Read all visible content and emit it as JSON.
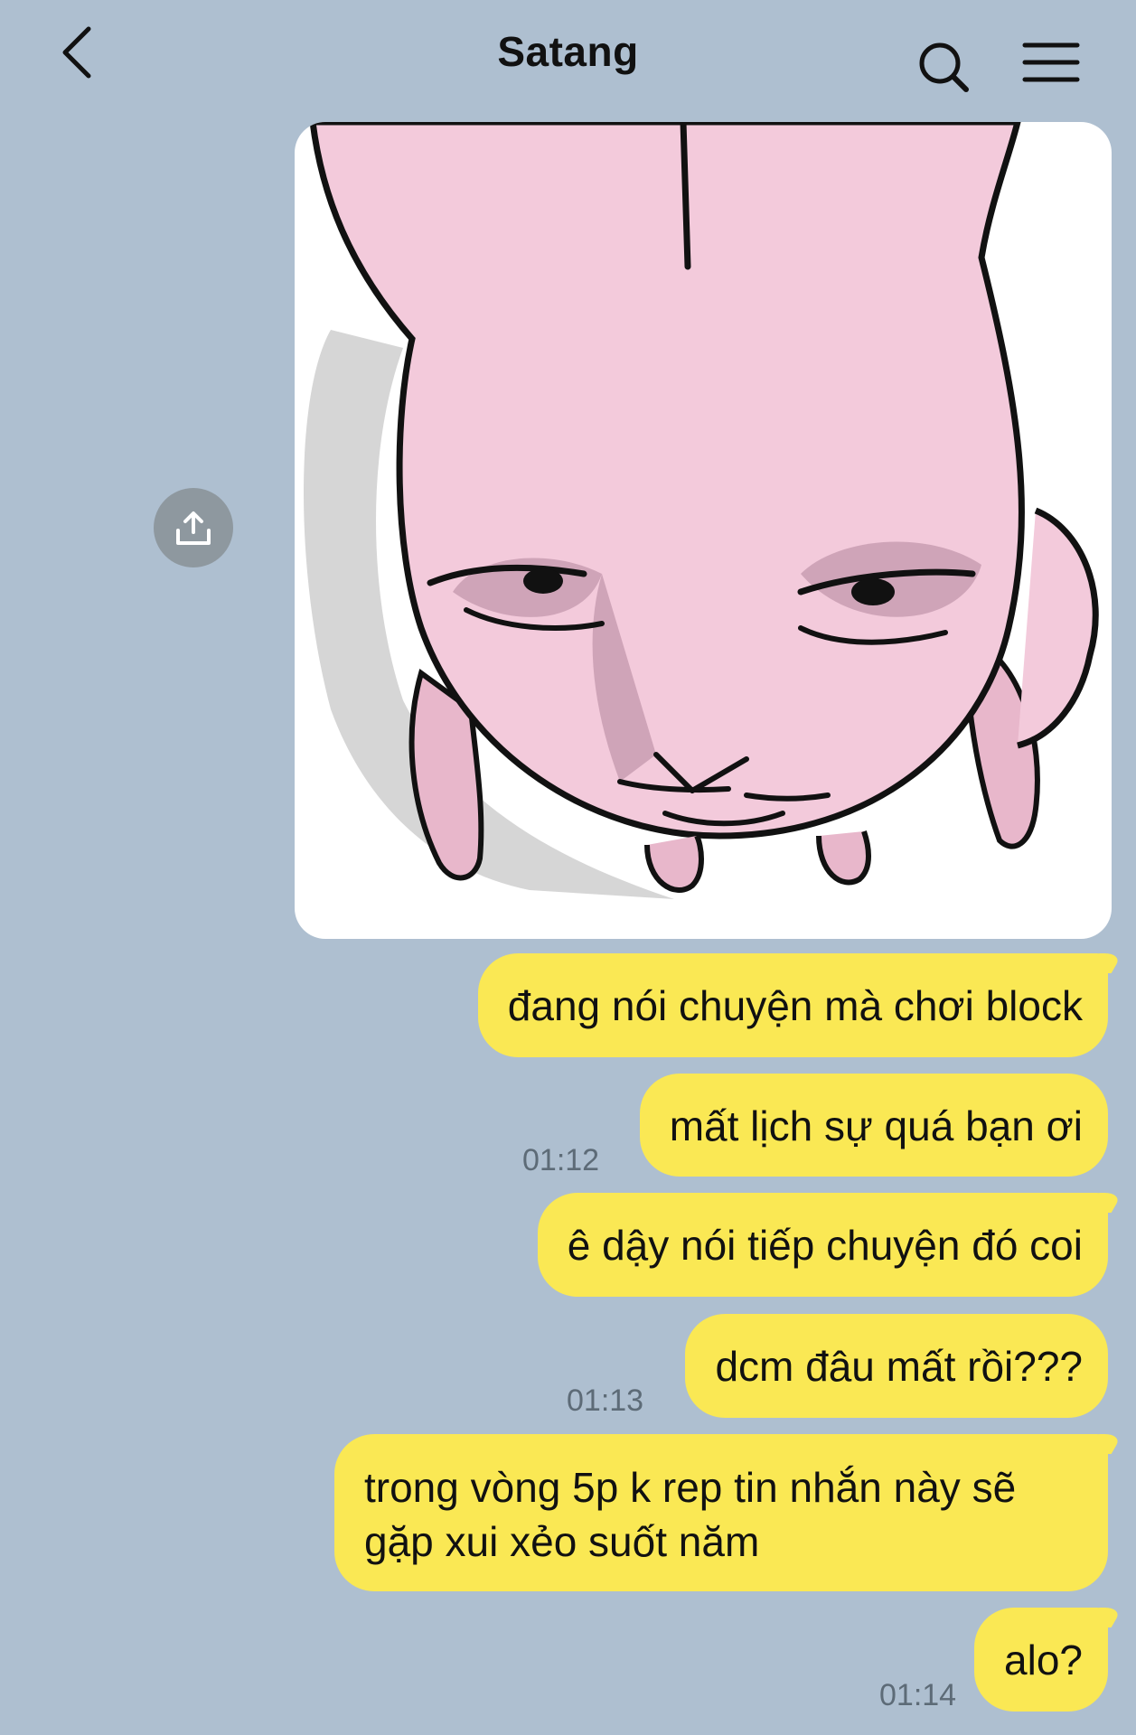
{
  "header": {
    "title": "Satang",
    "back_icon": "chevron-left-icon",
    "search_icon": "search-icon",
    "menu_icon": "hamburger-menu-icon"
  },
  "share_icon": "share-upload-icon",
  "sticker": {
    "description_icon": "pink-bunny-sticker"
  },
  "messages": [
    {
      "text": "đang nói chuyện mà chơi block",
      "time": ""
    },
    {
      "text": "mất lịch sự quá bạn ơi",
      "time": "01:12"
    },
    {
      "text": "ê dậy nói tiếp chuyện đó coi",
      "time": ""
    },
    {
      "text": "dcm đâu mất rồi???",
      "time": "01:13"
    },
    {
      "text": "trong vòng 5p k rep tin nhắn này sẽ gặp xui xẻo suốt năm",
      "time": ""
    },
    {
      "text": "alo?",
      "time": "01:14"
    }
  ],
  "colors": {
    "background": "#aebfd0",
    "bubble": "#fae854",
    "sticker_pink": "#f3cadb"
  }
}
